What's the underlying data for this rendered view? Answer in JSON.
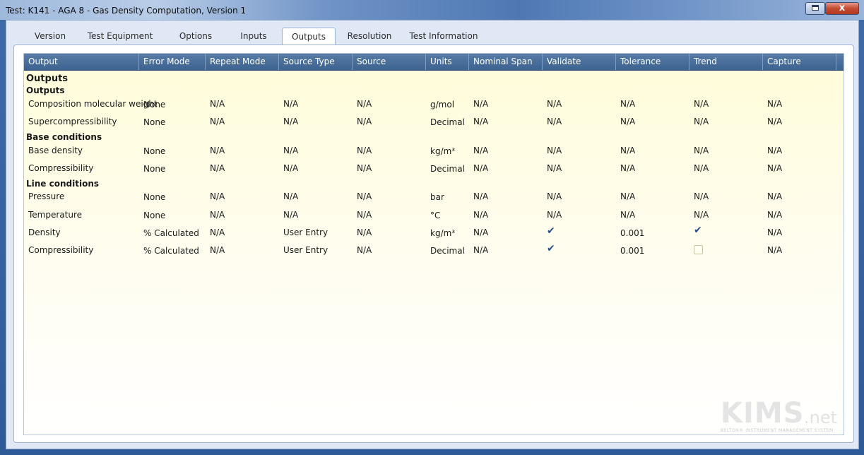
{
  "window": {
    "title": "Test: K141 - AGA 8 - Gas Density Computation, Version 1",
    "close_glyph": "x"
  },
  "tabs": [
    {
      "label": "Version"
    },
    {
      "label": "Test Equipment"
    },
    {
      "label": "Options"
    },
    {
      "label": "Inputs"
    },
    {
      "label": "Outputs",
      "active": true
    },
    {
      "label": "Resolution"
    },
    {
      "label": "Test Information"
    }
  ],
  "grid": {
    "columns": [
      "Output",
      "Error Mode",
      "Repeat Mode",
      "Source Type",
      "Source",
      "Units",
      "Nominal Span",
      "Validate",
      "Tolerance",
      "Trend",
      "Capture"
    ],
    "title": "Outputs",
    "groups": [
      {
        "name": "Outputs",
        "rows": [
          {
            "output": "Composition molecular weight",
            "error_mode": "None",
            "repeat_mode": "N/A",
            "source_type": "N/A",
            "source": "N/A",
            "units": "g/mol",
            "nominal_span": "N/A",
            "validate": "N/A",
            "tolerance": "N/A",
            "trend": "N/A",
            "capture": "N/A"
          },
          {
            "output": "Supercompressibility",
            "error_mode": "None",
            "repeat_mode": "N/A",
            "source_type": "N/A",
            "source": "N/A",
            "units": "Decimal",
            "nominal_span": "N/A",
            "validate": "N/A",
            "tolerance": "N/A",
            "trend": "N/A",
            "capture": "N/A"
          }
        ]
      },
      {
        "name": "Base conditions",
        "rows": [
          {
            "output": "Base density",
            "error_mode": "None",
            "repeat_mode": "N/A",
            "source_type": "N/A",
            "source": "N/A",
            "units": "kg/m³",
            "nominal_span": "N/A",
            "validate": "N/A",
            "tolerance": "N/A",
            "trend": "N/A",
            "capture": "N/A"
          },
          {
            "output": "Compressibility",
            "error_mode": "None",
            "repeat_mode": "N/A",
            "source_type": "N/A",
            "source": "N/A",
            "units": "Decimal",
            "nominal_span": "N/A",
            "validate": "N/A",
            "tolerance": "N/A",
            "trend": "N/A",
            "capture": "N/A"
          }
        ]
      },
      {
        "name": "Line conditions",
        "rows": [
          {
            "output": "Pressure",
            "error_mode": "None",
            "repeat_mode": "N/A",
            "source_type": "N/A",
            "source": "N/A",
            "units": "bar",
            "nominal_span": "N/A",
            "validate": "N/A",
            "tolerance": "N/A",
            "trend": "N/A",
            "capture": "N/A"
          },
          {
            "output": "Temperature",
            "error_mode": "None",
            "repeat_mode": "N/A",
            "source_type": "N/A",
            "source": "N/A",
            "units": "°C",
            "nominal_span": "N/A",
            "validate": "N/A",
            "tolerance": "N/A",
            "trend": "N/A",
            "capture": "N/A"
          },
          {
            "output": "Density",
            "error_mode": "% Calculated",
            "repeat_mode": "N/A",
            "source_type": "User Entry",
            "source": "N/A",
            "units": "kg/m³",
            "nominal_span": "N/A",
            "validate": true,
            "tolerance": "0.001",
            "trend": true,
            "capture": "N/A"
          },
          {
            "output": "Compressibility",
            "error_mode": "% Calculated",
            "repeat_mode": "N/A",
            "source_type": "User Entry",
            "source": "N/A",
            "units": "Decimal",
            "nominal_span": "N/A",
            "validate": true,
            "tolerance": "0.001",
            "trend": false,
            "capture": "N/A"
          }
        ]
      }
    ]
  },
  "logo": {
    "main": "KIMS",
    "net": ".net",
    "tagline": "BELTON® INSTRUMENT MANAGEMENT SYSTEM"
  },
  "colors": {
    "header_bg": "#4a6f9c",
    "grid_bg": "#fffde0",
    "check": "#2c4f8a"
  }
}
